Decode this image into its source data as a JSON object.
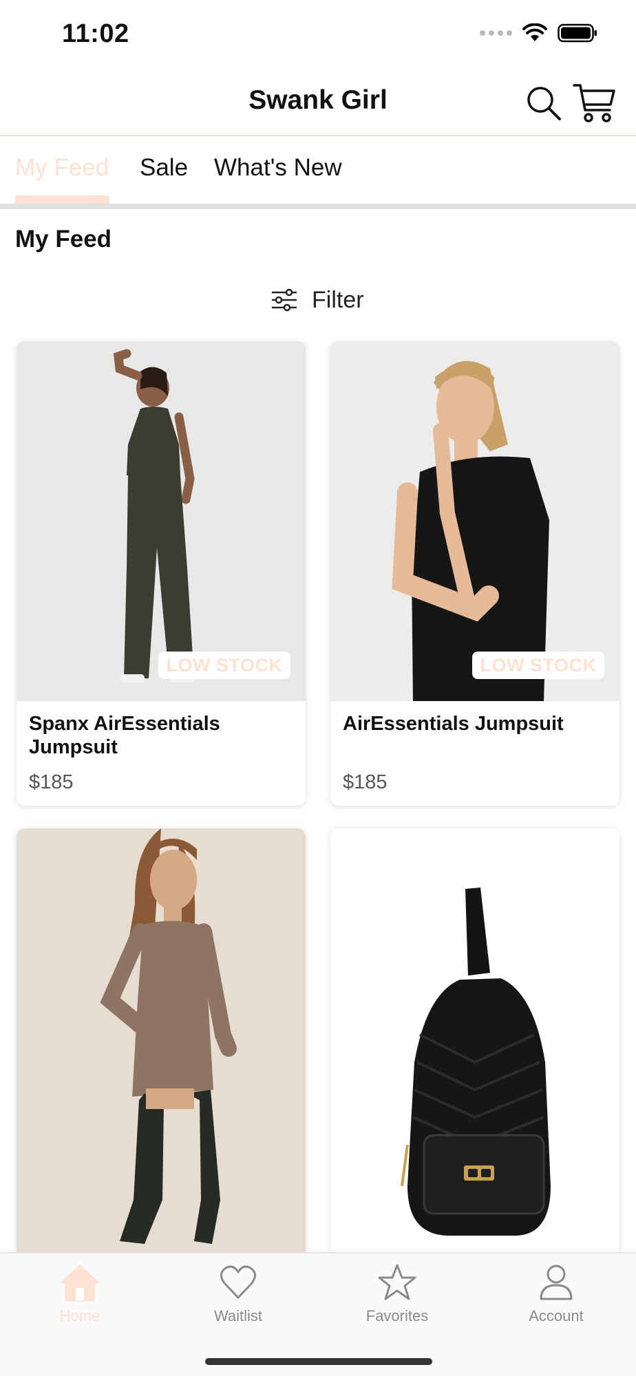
{
  "status_bar": {
    "time": "11:02"
  },
  "header": {
    "title": "Swank Girl"
  },
  "tabs": [
    {
      "label": "My Feed",
      "active": true
    },
    {
      "label": "Sale",
      "active": false
    },
    {
      "label": "What's New",
      "active": false
    }
  ],
  "feed": {
    "heading": "My Feed",
    "filter_label": "Filter"
  },
  "products": [
    {
      "name": "Spanx AirEssentials Jumpsuit",
      "price": "$185",
      "badge": "LOW STOCK"
    },
    {
      "name": "AirEssentials Jumpsuit",
      "price": "$185",
      "badge": "LOW STOCK"
    },
    {
      "name": "",
      "price": ""
    },
    {
      "name": "",
      "price": ""
    }
  ],
  "bottom_nav": [
    {
      "label": "Home",
      "icon": "home-icon",
      "active": true
    },
    {
      "label": "Waitlist",
      "icon": "heart-icon",
      "active": false
    },
    {
      "label": "Favorites",
      "icon": "star-icon",
      "active": false
    },
    {
      "label": "Account",
      "icon": "person-icon",
      "active": false
    }
  ],
  "colors": {
    "accent": "#fde2d3",
    "text": "#111111",
    "muted": "#8a8a8a",
    "divider": "#e2e2e2"
  }
}
